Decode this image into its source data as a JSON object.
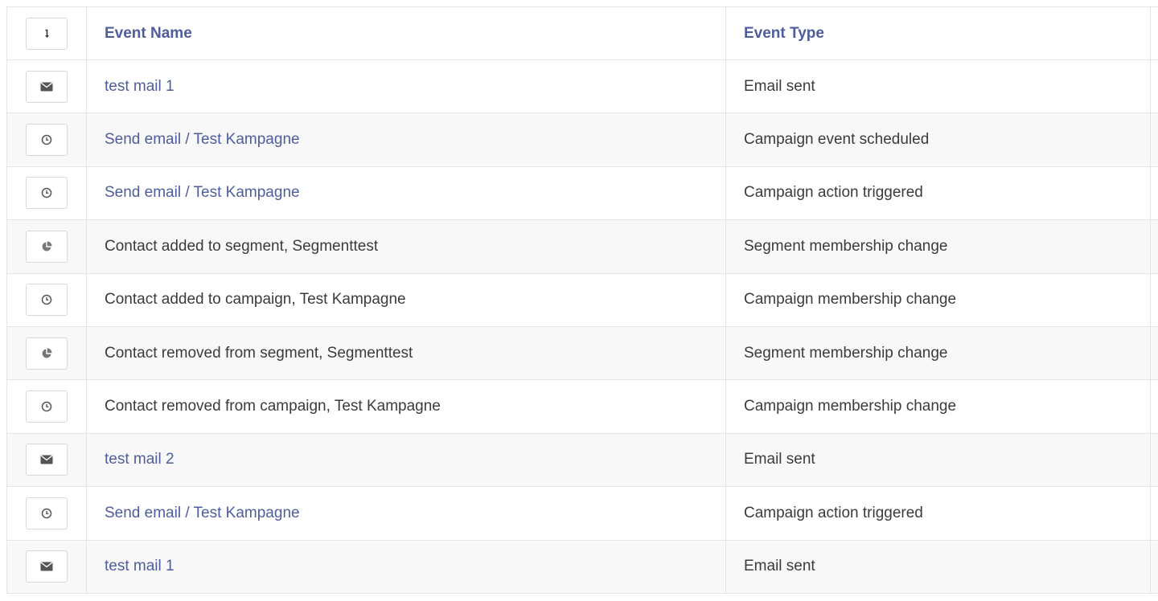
{
  "table": {
    "headers": {
      "sort_icon": "sort-down-icon",
      "event_name": "Event Name",
      "event_type": "Event Type"
    },
    "rows": [
      {
        "icon": "envelope-icon",
        "name": "test mail 1",
        "name_is_link": true,
        "type": "Email sent"
      },
      {
        "icon": "clock-icon",
        "name": "Send email / Test Kampagne",
        "name_is_link": true,
        "type": "Campaign event scheduled"
      },
      {
        "icon": "clock-icon",
        "name": "Send email / Test Kampagne",
        "name_is_link": true,
        "type": "Campaign action triggered"
      },
      {
        "icon": "pie-chart-icon",
        "name": "Contact added to segment, Segmenttest",
        "name_is_link": false,
        "type": "Segment membership change"
      },
      {
        "icon": "clock-icon",
        "name": "Contact added to campaign, Test Kampagne",
        "name_is_link": false,
        "type": "Campaign membership change"
      },
      {
        "icon": "pie-chart-icon",
        "name": "Contact removed from segment, Segmenttest",
        "name_is_link": false,
        "type": "Segment membership change"
      },
      {
        "icon": "clock-icon",
        "name": "Contact removed from campaign, Test Kampagne",
        "name_is_link": false,
        "type": "Campaign membership change"
      },
      {
        "icon": "envelope-icon",
        "name": "test mail 2",
        "name_is_link": true,
        "type": "Email sent"
      },
      {
        "icon": "clock-icon",
        "name": "Send email / Test Kampagne",
        "name_is_link": true,
        "type": "Campaign action triggered"
      },
      {
        "icon": "envelope-icon",
        "name": "test mail 1",
        "name_is_link": true,
        "type": "Email sent"
      }
    ]
  },
  "colors": {
    "link": "#4e5d9d",
    "text": "#3b3b3b",
    "border": "#e4e5ea",
    "row_alt": "#f8f8f9"
  }
}
